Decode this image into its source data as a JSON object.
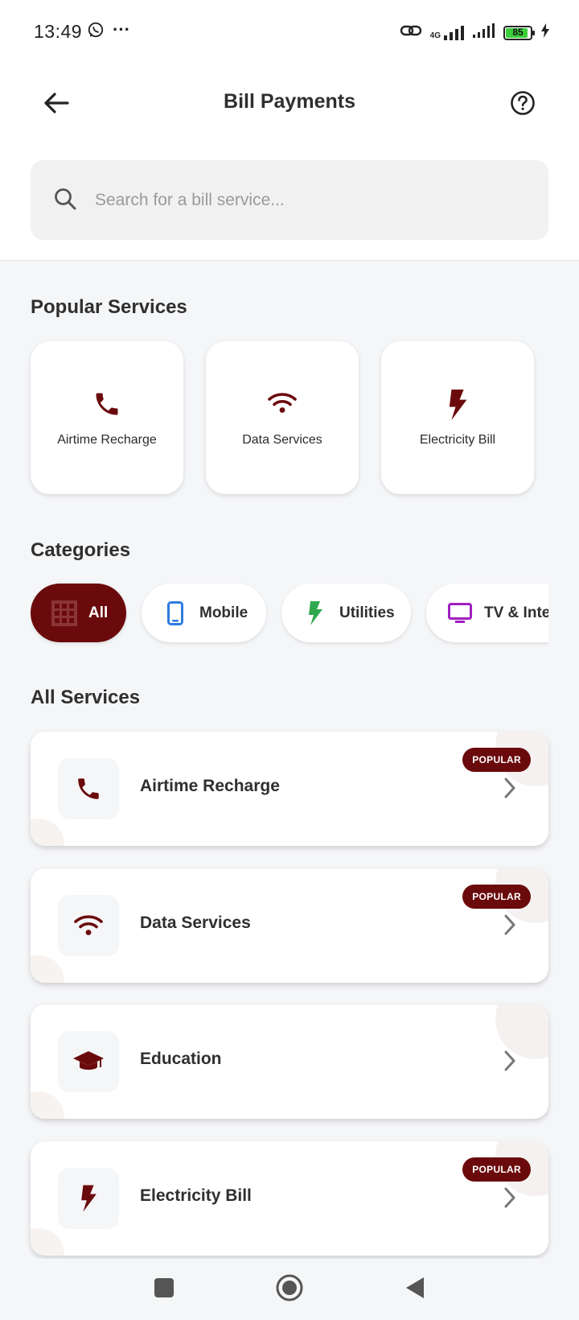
{
  "status_bar": {
    "time": "13:49",
    "network_label": "4G",
    "battery_level": 85,
    "battery_text": "85"
  },
  "header": {
    "title": "Bill Payments",
    "back_icon": "arrow-left-icon",
    "help_icon": "help-circle-icon"
  },
  "search": {
    "placeholder": "Search for a bill service...",
    "value": ""
  },
  "popular": {
    "title": "Popular Services",
    "items": [
      {
        "label": "Airtime Recharge",
        "icon": "phone-icon"
      },
      {
        "label": "Data Services",
        "icon": "wifi-icon"
      },
      {
        "label": "Electricity Bill",
        "icon": "bolt-icon"
      }
    ]
  },
  "categories": {
    "title": "Categories",
    "items": [
      {
        "label": "All",
        "icon": "grid-icon",
        "active": true
      },
      {
        "label": "Mobile",
        "icon": "smartphone-icon",
        "active": false
      },
      {
        "label": "Utilities",
        "icon": "bolt-icon",
        "active": false
      },
      {
        "label": "TV & Internet",
        "icon": "tv-icon",
        "active": false
      }
    ]
  },
  "services": {
    "title": "All Services",
    "items": [
      {
        "name": "Airtime Recharge",
        "badge": "POPULAR",
        "icon": "phone-icon"
      },
      {
        "name": "Data Services",
        "badge": "POPULAR",
        "icon": "wifi-icon"
      },
      {
        "name": "Education",
        "badge": "",
        "icon": "graduation-cap-icon"
      },
      {
        "name": "Electricity Bill",
        "badge": "POPULAR",
        "icon": "bolt-icon"
      }
    ]
  },
  "colors": {
    "brand": "#6b0a0c",
    "mobile_icon": "#2f7de1",
    "utilities_icon": "#2fa84f",
    "tv_icon": "#a020c0",
    "background": "#f5f6f8"
  }
}
